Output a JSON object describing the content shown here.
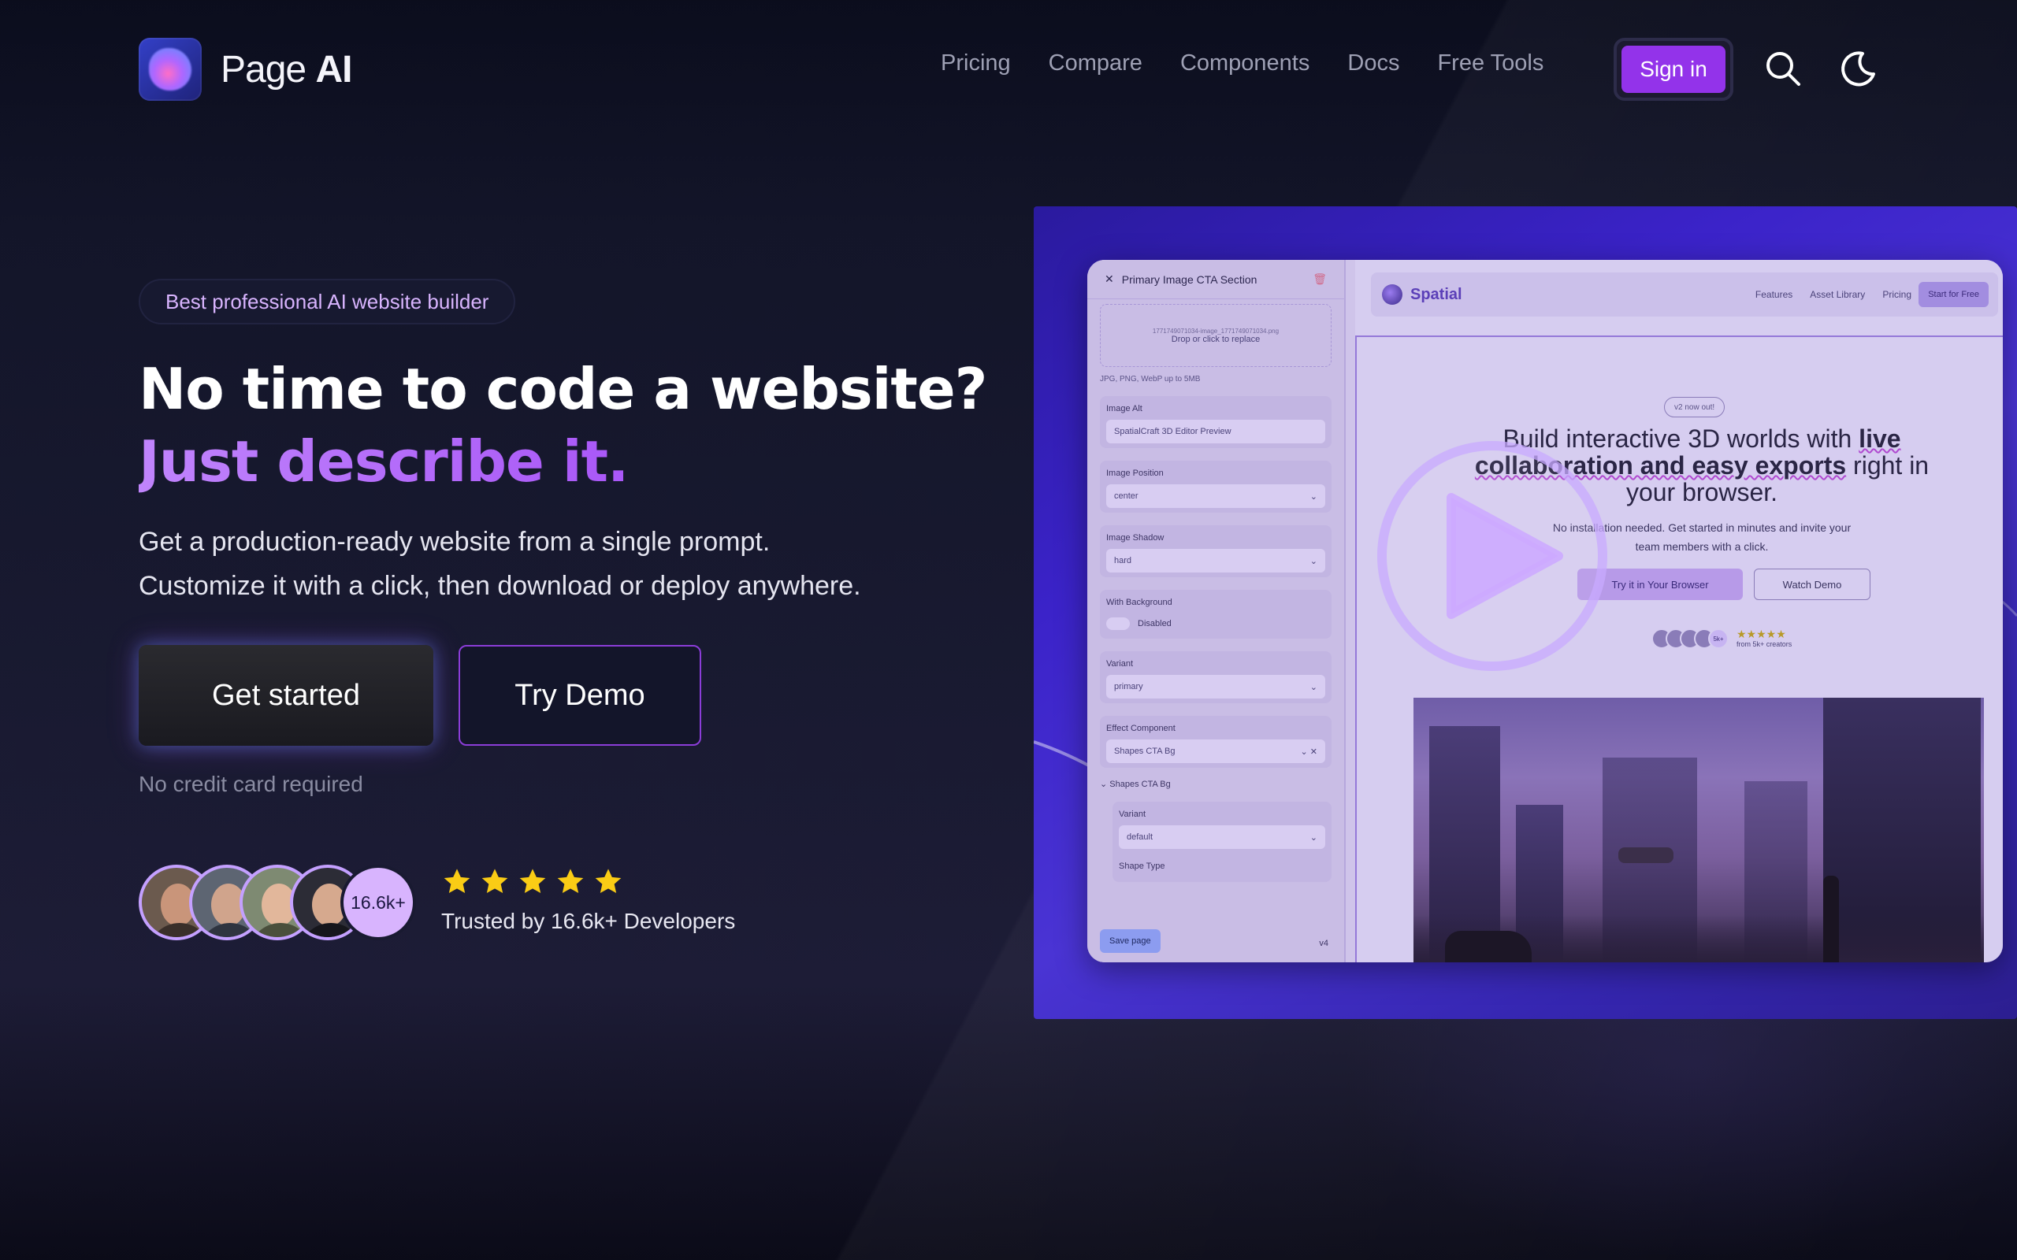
{
  "brand": {
    "name_light": "Page",
    "name_bold": "AI"
  },
  "nav": {
    "links": [
      "Pricing",
      "Compare",
      "Components",
      "Docs",
      "Free Tools"
    ],
    "signin": "Sign in"
  },
  "hero": {
    "badge": "Best professional AI website builder",
    "title_line1": "No time to code a website?",
    "title_line2": "Just describe it.",
    "subtitle_line1": "Get a production-ready website from a single prompt.",
    "subtitle_line2": "Customize it with a click, then download or deploy anywhere.",
    "cta_primary": "Get started",
    "cta_secondary": "Try Demo",
    "note": "No credit card required",
    "avatar_count": "16.6k+",
    "rating": 5,
    "trust": "Trusted by 16.6k+ Developers"
  },
  "editor": {
    "panel_title": "Primary Image CTA Section",
    "file_name": "1771749071034-image_1771749071034.png",
    "drop_text": "Drop or click to replace",
    "file_hint": "JPG, PNG, WebP up to 5MB",
    "fields": [
      {
        "label": "Image Alt",
        "value": "SpatialCraft 3D Editor Preview"
      },
      {
        "label": "Image Position",
        "value": "center"
      },
      {
        "label": "Image Shadow",
        "value": "hard"
      },
      {
        "label": "With Background",
        "value": "Disabled"
      },
      {
        "label": "Variant",
        "value": "primary"
      }
    ],
    "effect_label": "Effect Component",
    "effect_value": "Shapes CTA Bg",
    "effect_section": "Shapes CTA Bg",
    "sub_variant_label": "Variant",
    "sub_variant_value": "default",
    "shape_type_label": "Shape Type",
    "save": "Save page",
    "version": "v4"
  },
  "site_preview": {
    "name": "Spatial",
    "links": [
      "Features",
      "Asset Library",
      "Pricing"
    ],
    "cta": "Start for Free",
    "pill": "v2 now out!",
    "headline_plain": "Build interactive 3D worlds with",
    "headline_bold": "live collaboration and easy exports",
    "headline_end": "right in your browser.",
    "paragraph": "No installation needed. Get started in minutes and invite your team members with a click.",
    "btn_primary": "Try it in Your Browser",
    "btn_secondary": "Watch Demo",
    "avatar_more": "5k+",
    "rating_text": "from 5k+ creators"
  },
  "colors": {
    "accent": "#9333ea",
    "accent_light": "#c084fc",
    "star": "#facc15",
    "background": "#151629"
  }
}
